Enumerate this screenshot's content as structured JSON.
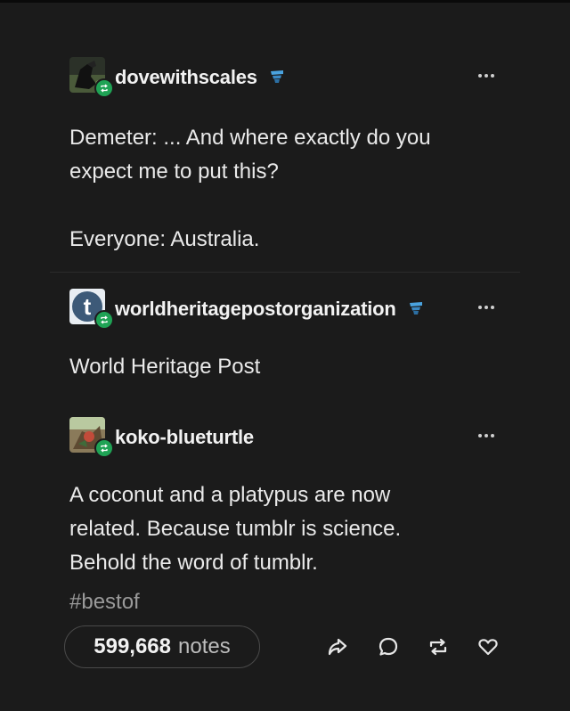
{
  "posts": [
    {
      "username": "dovewithscales",
      "text": "Demeter: ... And where exactly do you\nexpect me to put this?\n\nEveryone: Australia."
    },
    {
      "username": "worldheritagepostorganization",
      "avatar_letter": "t",
      "text": "World Heritage Post"
    },
    {
      "username": "koko-blueturtle",
      "text": "A coconut and a platypus are now\nrelated. Because tumblr is science.\nBehold the word of tumblr."
    }
  ],
  "tag": "#bestof",
  "footer": {
    "notes_count": "599,668",
    "notes_label": "notes"
  },
  "icons": {
    "more": "more-icon",
    "share": "share-icon",
    "reply": "reply-icon",
    "reblog": "reblog-icon",
    "like": "heart-icon"
  },
  "colors": {
    "background": "#1b1b1b",
    "reblog_badge": "#1fa355",
    "badge_blue": "#4aa3df"
  }
}
